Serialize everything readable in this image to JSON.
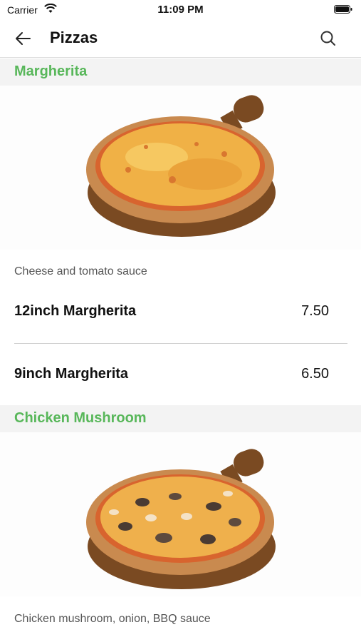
{
  "status": {
    "carrier": "Carrier",
    "time": "11:09 PM"
  },
  "header": {
    "title": "Pizzas",
    "back_icon": "arrow-left-icon",
    "search_icon": "search-icon"
  },
  "colors": {
    "accent": "#58b75a",
    "section_bg": "#f3f3f3"
  },
  "sections": [
    {
      "title": "Margherita",
      "description": "Cheese and tomato sauce",
      "items": [
        {
          "name": "12inch Margherita",
          "price": "7.50"
        },
        {
          "name": "9inch Margherita",
          "price": "6.50"
        }
      ]
    },
    {
      "title": "Chicken Mushroom",
      "description": "Chicken mushroom, onion, BBQ sauce",
      "items": []
    }
  ]
}
